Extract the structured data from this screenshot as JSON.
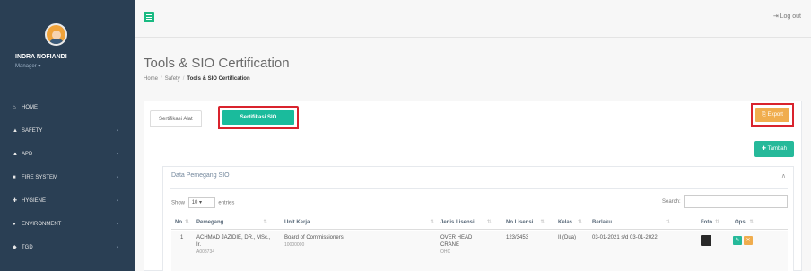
{
  "sidebar": {
    "user_name": "INDRA NOFIANDI",
    "user_role": "Manager ▾",
    "items": [
      {
        "icon": "home-icon",
        "glyph": "⌂",
        "label": "Home",
        "has_children": false
      },
      {
        "icon": "safety-icon",
        "glyph": "▲",
        "label": "SAFETY",
        "has_children": true
      },
      {
        "icon": "apd-icon",
        "glyph": "▲",
        "label": "APD",
        "has_children": true
      },
      {
        "icon": "fire-extinguisher-icon",
        "glyph": "■",
        "label": "FIRE SYSTEM",
        "has_children": true
      },
      {
        "icon": "hygiene-icon",
        "glyph": "✚",
        "label": "HYGIENE",
        "has_children": true
      },
      {
        "icon": "environment-icon",
        "glyph": "●",
        "label": "ENVIRONMENT",
        "has_children": true
      },
      {
        "icon": "tgd-icon",
        "glyph": "◆",
        "label": "TGD",
        "has_children": true
      }
    ],
    "chevron": "‹"
  },
  "topbar": {
    "logout_label": "⇥ Log out"
  },
  "page": {
    "title": "Tools & SIO Certification",
    "breadcrumb": [
      "Home",
      "Safety",
      "Tools & SIO Certification"
    ],
    "breadcrumb_sep": "/"
  },
  "tabs": {
    "alat": "Sertifikasi Alat",
    "sio": "Sertifikasi SIO"
  },
  "buttons": {
    "export": "⎘ Export",
    "tambah": "✚ Tambah"
  },
  "table_panel": {
    "title": "Data Pemegang SIO",
    "collapse": "∧",
    "show_label": "Show",
    "show_value": "10",
    "entries_label": "entries",
    "search_label": "Search:",
    "sort_glyph": "⇅",
    "columns": [
      "No",
      "Pemegang",
      "Unit Kerja",
      "Jenis Lisensi",
      "No Lisensi",
      "Kelas",
      "Berlaku",
      "Foto",
      "Opsi"
    ],
    "rows": [
      {
        "no": "1",
        "pemegang": "ACHMAD JAZIDIE, DR., MSc., Ir.",
        "pemegang_id": "A008734",
        "unit_kerja": "Board of Commissioners",
        "unit_kerja_code": "10000000",
        "jenis_lisensi": "OVER HEAD CRANE",
        "jenis_lisensi_sub": "OHC",
        "no_lisensi": "123/3453",
        "kelas": "II (Dua)",
        "berlaku": "03-01-2021 s/d 03-01-2022",
        "edit_glyph": "✎",
        "delete_glyph": "✕"
      }
    ]
  },
  "colors": {
    "sidebar_bg": "#2a3f54",
    "accent_green": "#1abb9c",
    "export_orange": "#f0ad4e",
    "highlight_red": "#d9232d"
  }
}
